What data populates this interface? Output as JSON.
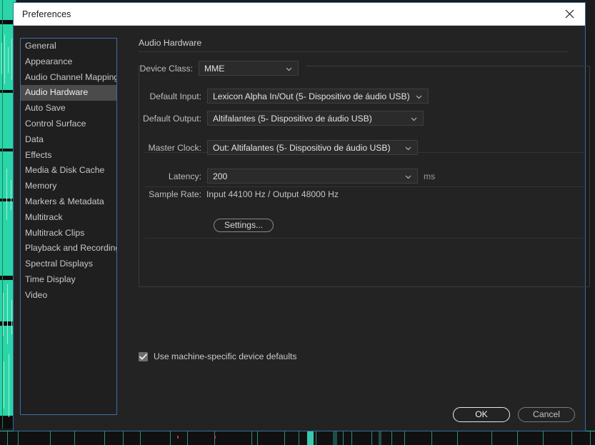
{
  "window": {
    "title": "Preferences",
    "close_icon": "close-icon"
  },
  "sidebar": {
    "items": [
      {
        "label": "General",
        "selected": false
      },
      {
        "label": "Appearance",
        "selected": false
      },
      {
        "label": "Audio Channel Mapping",
        "selected": false
      },
      {
        "label": "Audio Hardware",
        "selected": true
      },
      {
        "label": "Auto Save",
        "selected": false
      },
      {
        "label": "Control Surface",
        "selected": false
      },
      {
        "label": "Data",
        "selected": false
      },
      {
        "label": "Effects",
        "selected": false
      },
      {
        "label": "Media & Disk Cache",
        "selected": false
      },
      {
        "label": "Memory",
        "selected": false
      },
      {
        "label": "Markers & Metadata",
        "selected": false
      },
      {
        "label": "Multitrack",
        "selected": false
      },
      {
        "label": "Multitrack Clips",
        "selected": false
      },
      {
        "label": "Playback and Recording",
        "selected": false
      },
      {
        "label": "Spectral Displays",
        "selected": false
      },
      {
        "label": "Time Display",
        "selected": false
      },
      {
        "label": "Video",
        "selected": false
      }
    ]
  },
  "main": {
    "section_title": "Audio Hardware",
    "device_class": {
      "label": "Device Class:",
      "value": "MME"
    },
    "default_input": {
      "label": "Default Input:",
      "value": "Lexicon Alpha In/Out (5- Dispositivo de áudio USB)"
    },
    "default_output": {
      "label": "Default Output:",
      "value": "Altifalantes (5- Dispositivo de áudio USB)"
    },
    "master_clock": {
      "label": "Master Clock:",
      "value": "Out: Altifalantes (5- Dispositivo de áudio USB)"
    },
    "latency": {
      "label": "Latency:",
      "value": "200",
      "unit": "ms"
    },
    "sample_rate": {
      "label": "Sample Rate:",
      "value": "Input 44100 Hz / Output 48000 Hz"
    },
    "settings_button": "Settings...",
    "machine_defaults": {
      "label": "Use machine-specific device defaults",
      "checked": true
    }
  },
  "footer": {
    "ok_label": "OK",
    "cancel_label": "Cancel"
  },
  "colors": {
    "dialog_bg": "#232323",
    "titlebar_bg": "#ffffff",
    "sidebar_bg": "#1f1f1f",
    "selection_bg": "#4b4b4b",
    "dialog_border": "#2f6fa8",
    "sidebar_border": "#3a6ea5",
    "waveform": "#2ad6a8"
  }
}
